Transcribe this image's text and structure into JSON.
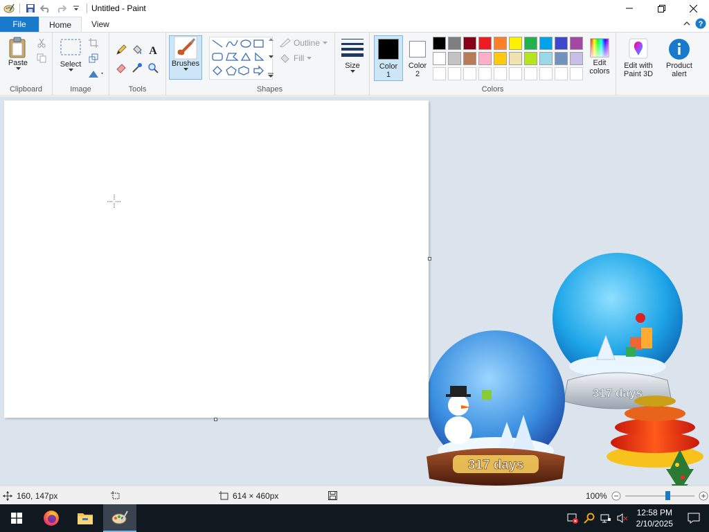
{
  "window": {
    "title": "Untitled - Paint"
  },
  "menu": {
    "file_label": "File",
    "tabs": [
      {
        "label": "Home",
        "active": true
      },
      {
        "label": "View",
        "active": false
      }
    ]
  },
  "ribbon": {
    "clipboard": {
      "group_label": "Clipboard",
      "paste_label": "Paste"
    },
    "image": {
      "group_label": "Image",
      "select_label": "Select"
    },
    "tools": {
      "group_label": "Tools"
    },
    "brushes": {
      "label": "Brushes"
    },
    "shapes": {
      "group_label": "Shapes",
      "outline_label": "Outline",
      "fill_label": "Fill"
    },
    "size": {
      "label": "Size"
    },
    "colors": {
      "group_label": "Colors",
      "color1_line1": "Color",
      "color1_line2": "1",
      "color2_line1": "Color",
      "color2_line2": "2",
      "color1_value": "#000000",
      "color2_value": "#ffffff",
      "palette_row1": [
        "#000000",
        "#7f7f7f",
        "#880015",
        "#ed1c24",
        "#ff7f27",
        "#fff200",
        "#22b14c",
        "#00a2e8",
        "#3f48cc",
        "#a349a4"
      ],
      "palette_row2": [
        "#ffffff",
        "#c3c3c3",
        "#b97a57",
        "#ffaec9",
        "#ffc90e",
        "#efe4b0",
        "#b5e61d",
        "#99d9ea",
        "#7092be",
        "#c8bfe7"
      ],
      "edit_colors_line1": "Edit",
      "edit_colors_line2": "colors"
    },
    "paint3d": {
      "line1": "Edit with",
      "line2": "Paint 3D"
    },
    "alert": {
      "line1": "Product",
      "line2": "alert"
    }
  },
  "wallpaper": {
    "globe_left_caption": "317 days",
    "globe_right_caption": "317 days"
  },
  "status": {
    "cursor_position": "160, 147px",
    "canvas_size": "614 × 460px",
    "zoom": "100%"
  },
  "taskbar": {
    "time": "12:58 PM",
    "date": "2/10/2025"
  }
}
